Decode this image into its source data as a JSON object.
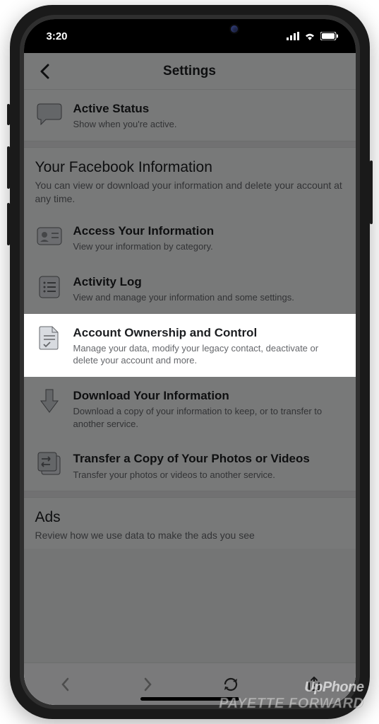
{
  "status_bar": {
    "time": "3:20"
  },
  "header": {
    "title": "Settings"
  },
  "top_row": {
    "title": "Active Status",
    "sub": "Show when you're active."
  },
  "section_fbinfo": {
    "title": "Your Facebook Information",
    "sub": "You can view or download your information and delete your account at any time.",
    "items": [
      {
        "title": "Access Your Information",
        "sub": "View your information by category."
      },
      {
        "title": "Activity Log",
        "sub": "View and manage your information and some settings."
      },
      {
        "title": "Account Ownership and Control",
        "sub": "Manage your data, modify your legacy contact, deactivate or delete your account and more."
      },
      {
        "title": "Download Your Information",
        "sub": "Download a copy of your information to keep, or to transfer to another service."
      },
      {
        "title": "Transfer a Copy of Your Photos or Videos",
        "sub": "Transfer your photos or videos to another service."
      }
    ]
  },
  "section_ads": {
    "title": "Ads",
    "sub": "Review how we use data to make the ads you see"
  },
  "watermark": {
    "line1": "UpPhone",
    "line2": "PAYETTE FORWARD"
  }
}
